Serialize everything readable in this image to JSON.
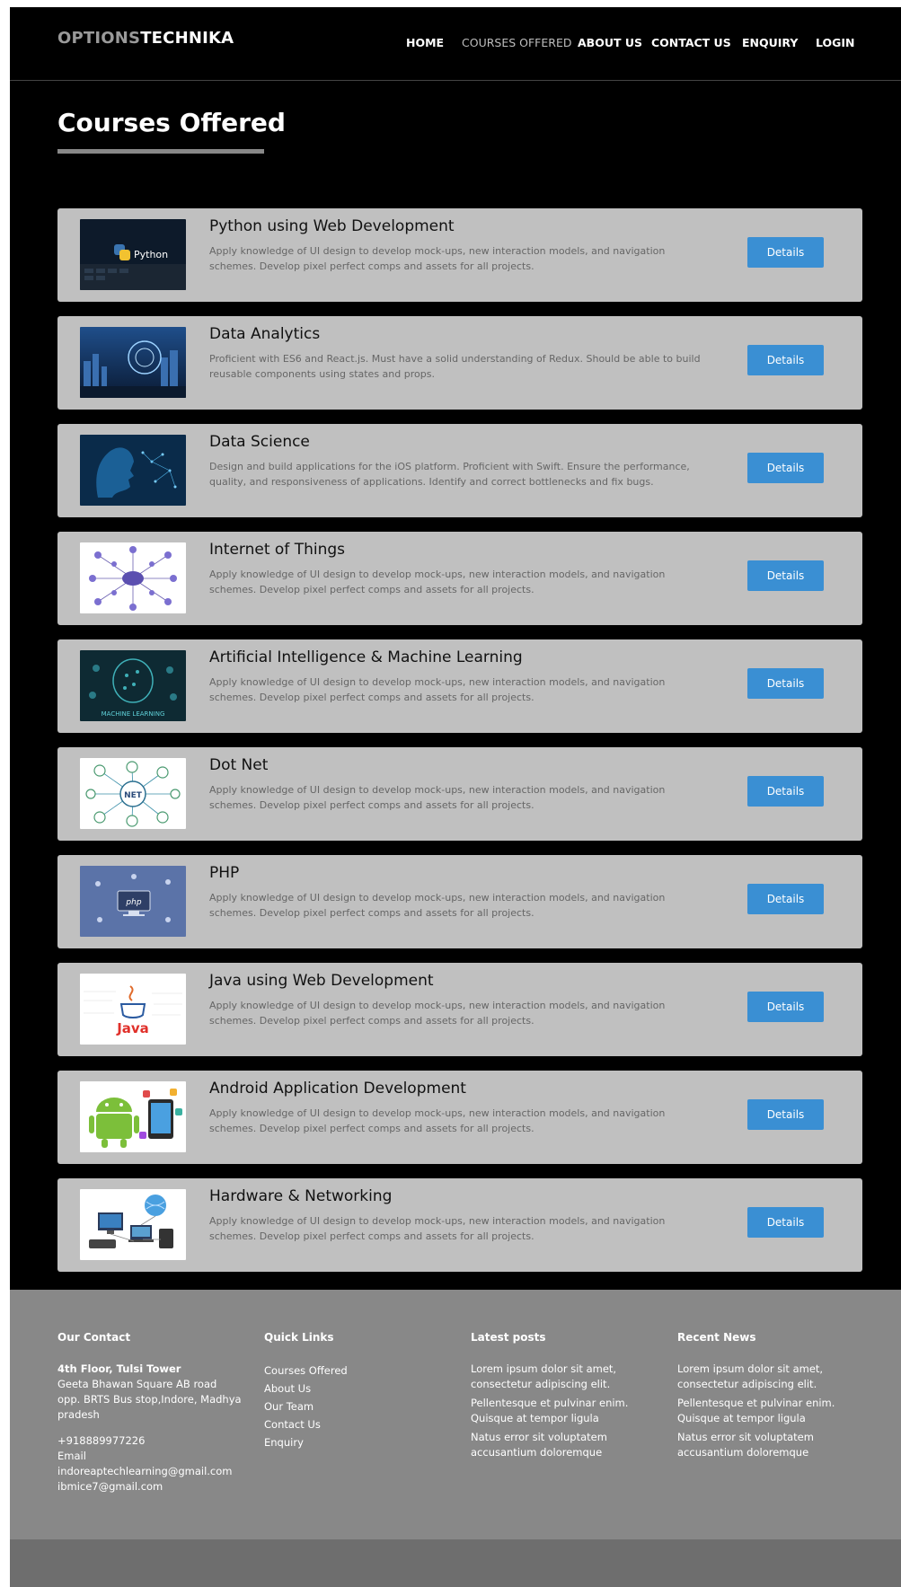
{
  "brand": {
    "part1": "OPTIONS",
    "part2": "TECHNIKA"
  },
  "nav": {
    "home": "HOME",
    "courses": "COURSES OFFERED",
    "about": "ABOUT US",
    "contact": "CONTACT US",
    "enquiry": "ENQUIRY",
    "login": "LOGIN"
  },
  "page_title": "Courses Offered",
  "details_label": "Details",
  "courses": [
    {
      "title": "Python using Web Development",
      "desc": "Apply knowledge of UI design to develop mock-ups, new interaction models, and navigation schemes. Develop pixel perfect comps and assets for all projects.",
      "image_icon": "python-thumbnail"
    },
    {
      "title": "Data Analytics",
      "desc": "Proficient with ES6 and React.js. Must have a solid understanding of Redux. Should be able to build reusable components using states and props.",
      "image_icon": "data-analytics-thumbnail"
    },
    {
      "title": "Data Science",
      "desc": "Design and build applications for the iOS platform. Proficient with Swift. Ensure the performance, quality, and responsiveness of applications. Identify and correct bottlenecks and fix bugs.",
      "image_icon": "data-science-thumbnail"
    },
    {
      "title": "Internet of Things",
      "desc": "Apply knowledge of UI design to develop mock-ups, new interaction models, and navigation schemes. Develop pixel perfect comps and assets for all projects.",
      "image_icon": "iot-thumbnail"
    },
    {
      "title": "Artificial Intelligence & Machine Learning",
      "desc": "Apply knowledge of UI design to develop mock-ups, new interaction models, and navigation schemes. Develop pixel perfect comps and assets for all projects.",
      "image_icon": "ai-ml-thumbnail"
    },
    {
      "title": "Dot Net",
      "desc": "Apply knowledge of UI design to develop mock-ups, new interaction models, and navigation schemes. Develop pixel perfect comps and assets for all projects.",
      "image_icon": "dotnet-thumbnail"
    },
    {
      "title": "PHP",
      "desc": "Apply knowledge of UI design to develop mock-ups, new interaction models, and navigation schemes. Develop pixel perfect comps and assets for all projects.",
      "image_icon": "php-thumbnail"
    },
    {
      "title": "Java using Web Development",
      "desc": "Apply knowledge of UI design to develop mock-ups, new interaction models, and navigation schemes. Develop pixel perfect comps and assets for all projects.",
      "image_icon": "java-thumbnail"
    },
    {
      "title": "Android Application Development",
      "desc": "Apply knowledge of UI design to develop mock-ups, new interaction models, and navigation schemes. Develop pixel perfect comps and assets for all projects.",
      "image_icon": "android-thumbnail"
    },
    {
      "title": "Hardware & Networking",
      "desc": "Apply knowledge of UI design to develop mock-ups, new interaction models, and navigation schemes. Develop pixel perfect comps and assets for all projects.",
      "image_icon": "hardware-networking-thumbnail"
    }
  ],
  "thumb_text": {
    "python": "Python",
    "php": "php",
    "java": "Java",
    "ml": "MACHINE LEARNING",
    "net": "NET"
  },
  "footer": {
    "contact": {
      "heading": "Our Contact",
      "addr_title": "4th Floor, Tulsi Tower",
      "addr_line1": "Geeta Bhawan Square AB road",
      "addr_line2": "opp. BRTS Bus stop,Indore, Madhya pradesh",
      "phone": "+918889977226",
      "email_label": "Email",
      "email1": "indoreaptechlearning@gmail.com",
      "email2": "ibmice7@gmail.com"
    },
    "quick_links": {
      "heading": "Quick Links",
      "items": [
        "Courses Offered",
        "About Us",
        "Our Team",
        "Contact Us",
        "Enquiry"
      ]
    },
    "latest_posts": {
      "heading": "Latest posts",
      "items": [
        "Lorem ipsum dolor sit amet, consectetur adipiscing elit.",
        "Pellentesque et pulvinar enim. Quisque at tempor ligula",
        "Natus error sit voluptatem accusantium doloremque"
      ]
    },
    "recent_news": {
      "heading": "Recent News",
      "items": [
        "Lorem ipsum dolor sit amet, consectetur adipiscing elit.",
        "Pellentesque et pulvinar enim. Quisque at tempor ligula",
        "Natus error sit voluptatem accusantium doloremque"
      ]
    }
  },
  "colors": {
    "background": "#000000",
    "card": "#c0c0c0",
    "button": "#3a8fd3",
    "footer": "#888888",
    "footer_bottom": "#6e6e6e"
  }
}
